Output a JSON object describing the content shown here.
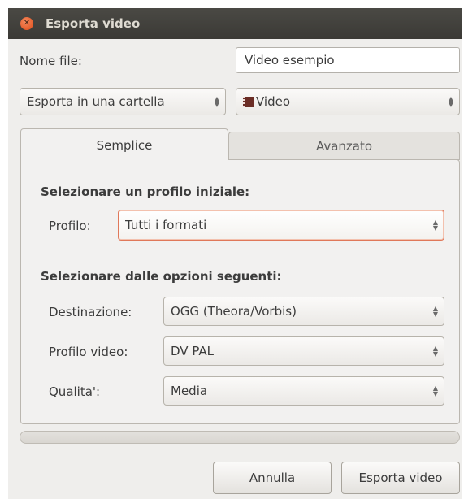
{
  "window": {
    "title": "Esporta video"
  },
  "file_name": {
    "label": "Nome file:",
    "value": "Video esempio"
  },
  "destination_mode": {
    "value": "Esporta in una cartella"
  },
  "media_type": {
    "value": "Video"
  },
  "tabs": [
    {
      "label": "Semplice",
      "active": true
    },
    {
      "label": "Avanzato",
      "active": false
    }
  ],
  "simple": {
    "initial_profile_heading": "Selezionare un profilo iniziale:",
    "profile_label": "Profilo:",
    "profile_value": "Tutti i formati",
    "options_heading": "Selezionare dalle opzioni seguenti:",
    "destination_label": "Destinazione:",
    "destination_value": "OGG (Theora/Vorbis)",
    "video_profile_label": "Profilo video:",
    "video_profile_value": "DV PAL",
    "quality_label": "Qualita':",
    "quality_value": "Media"
  },
  "progress": {
    "fraction": 0
  },
  "buttons": {
    "cancel": "Annulla",
    "export": "Esporta video"
  },
  "colors": {
    "titlebar": "#3b3a36",
    "close_button": "#df4a16",
    "focus_border": "#e0785a",
    "window_bg": "#efeeec"
  },
  "icons": {
    "close": "close-icon",
    "video": "film-icon",
    "combo_arrows": "up-down-arrows-icon"
  }
}
